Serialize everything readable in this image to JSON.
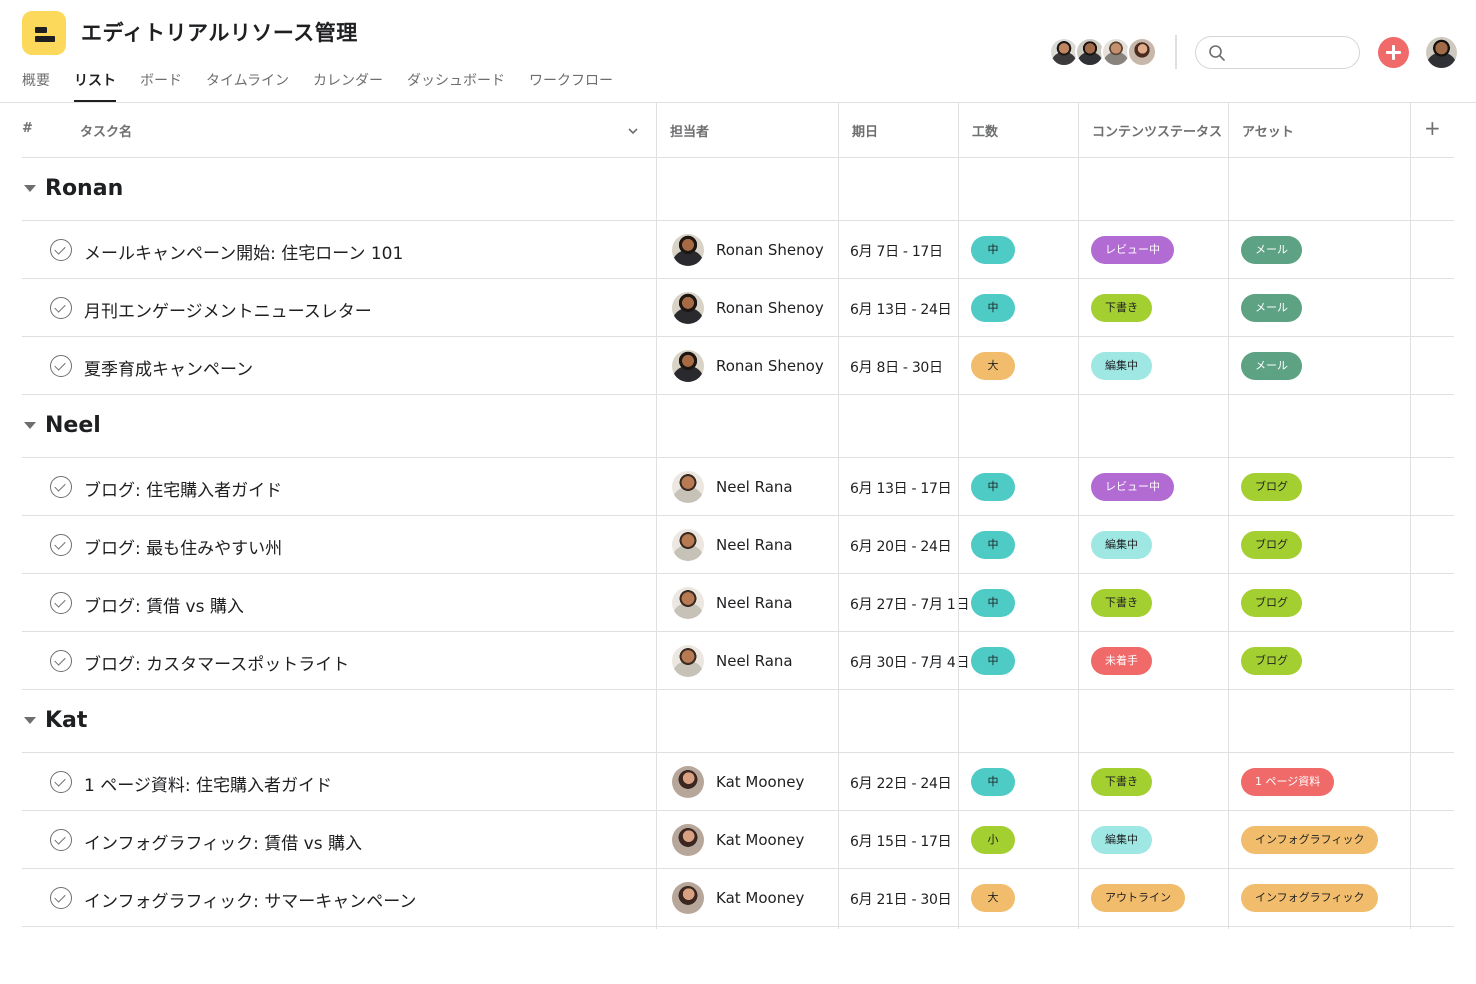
{
  "project": {
    "title": "エディトリアルリソース管理"
  },
  "tabs": [
    "概要",
    "リスト",
    "ボード",
    "タイムライン",
    "カレンダー",
    "ダッシュボード",
    "ワークフロー"
  ],
  "active_tab": "リスト",
  "search": {
    "placeholder": ""
  },
  "columns": {
    "number": "#",
    "task": "タスク名",
    "assignee": "担当者",
    "due": "期日",
    "effort": "工数",
    "status": "コンテンツステータス",
    "asset": "アセット",
    "add": "+"
  },
  "colors": {
    "effort_mid": "#4ecbc4",
    "effort_large": "#f1bd6c",
    "effort_small": "#9ee7e3",
    "status_review": "#b36bd4",
    "status_draft": "#a4cf30",
    "status_editing": "#9ee7e3",
    "status_not_started": "#f06a6a",
    "status_outline": "#f1bd6c",
    "asset_mail": "#5da283",
    "asset_blog": "#a4cf30",
    "asset_onepager": "#f06a6a",
    "asset_infographic": "#f1bd6c",
    "add_button": "#f06a6a",
    "app_icon": "#fcd95b"
  },
  "sections": [
    {
      "name": "Ronan",
      "tasks": [
        {
          "name": "メールキャンペーン開始: 住宅ローン 101",
          "assignee": "Ronan Shenoy",
          "due": "6月 7日 - 17日",
          "effort": "中",
          "effort_color": "#4ecbc4",
          "status": "レビュー中",
          "status_color": "#b36bd4",
          "status_text": "#ffffff",
          "asset": "メール",
          "asset_color": "#5da283",
          "asset_text": "#ffffff"
        },
        {
          "name": "月刊エンゲージメントニュースレター",
          "assignee": "Ronan Shenoy",
          "due": "6月 13日 - 24日",
          "effort": "中",
          "effort_color": "#4ecbc4",
          "status": "下書き",
          "status_color": "#a4cf30",
          "status_text": "#1e1f21",
          "asset": "メール",
          "asset_color": "#5da283",
          "asset_text": "#ffffff"
        },
        {
          "name": "夏季育成キャンペーン",
          "assignee": "Ronan Shenoy",
          "due": "6月 8日 - 30日",
          "effort": "大",
          "effort_color": "#f1bd6c",
          "status": "編集中",
          "status_color": "#9ee7e3",
          "status_text": "#1e1f21",
          "asset": "メール",
          "asset_color": "#5da283",
          "asset_text": "#ffffff"
        }
      ]
    },
    {
      "name": "Neel",
      "tasks": [
        {
          "name": "ブログ: 住宅購入者ガイド",
          "assignee": "Neel Rana",
          "due": "6月 13日 - 17日",
          "effort": "中",
          "effort_color": "#4ecbc4",
          "status": "レビュー中",
          "status_color": "#b36bd4",
          "status_text": "#ffffff",
          "asset": "ブログ",
          "asset_color": "#a4cf30",
          "asset_text": "#1e1f21"
        },
        {
          "name": "ブログ: 最も住みやすい州",
          "assignee": "Neel Rana",
          "due": "6月 20日 - 24日",
          "effort": "中",
          "effort_color": "#4ecbc4",
          "status": "編集中",
          "status_color": "#9ee7e3",
          "status_text": "#1e1f21",
          "asset": "ブログ",
          "asset_color": "#a4cf30",
          "asset_text": "#1e1f21"
        },
        {
          "name": "ブログ: 賃借 vs 購入",
          "assignee": "Neel Rana",
          "due": "6月 27日 - 7月 1日",
          "effort": "中",
          "effort_color": "#4ecbc4",
          "status": "下書き",
          "status_color": "#a4cf30",
          "status_text": "#1e1f21",
          "asset": "ブログ",
          "asset_color": "#a4cf30",
          "asset_text": "#1e1f21"
        },
        {
          "name": "ブログ: カスタマースポットライト",
          "assignee": "Neel Rana",
          "due": "6月 30日 - 7月 4日",
          "effort": "中",
          "effort_color": "#4ecbc4",
          "status": "未着手",
          "status_color": "#f06a6a",
          "status_text": "#ffffff",
          "asset": "ブログ",
          "asset_color": "#a4cf30",
          "asset_text": "#1e1f21"
        }
      ]
    },
    {
      "name": "Kat",
      "tasks": [
        {
          "name": "1 ページ資料: 住宅購入者ガイド",
          "assignee": "Kat Mooney",
          "due": "6月 22日 - 24日",
          "effort": "中",
          "effort_color": "#4ecbc4",
          "status": "下書き",
          "status_color": "#a4cf30",
          "status_text": "#1e1f21",
          "asset": "1 ページ資料",
          "asset_color": "#f06a6a",
          "asset_text": "#ffffff"
        },
        {
          "name": "インフォグラフィック: 賃借 vs 購入",
          "assignee": "Kat Mooney",
          "due": "6月 15日 - 17日",
          "effort": "小",
          "effort_color": "#a4cf30",
          "status": "編集中",
          "status_color": "#9ee7e3",
          "status_text": "#1e1f21",
          "asset": "インフォグラフィック",
          "asset_color": "#f1bd6c",
          "asset_text": "#1e1f21"
        },
        {
          "name": "インフォグラフィック: サマーキャンペーン",
          "assignee": "Kat Mooney",
          "due": "6月 21日 - 30日",
          "effort": "大",
          "effort_color": "#f1bd6c",
          "status": "アウトライン",
          "status_color": "#f1bd6c",
          "status_text": "#1e1f21",
          "asset": "インフォグラフィック",
          "asset_color": "#f1bd6c",
          "asset_text": "#1e1f21"
        }
      ]
    }
  ]
}
